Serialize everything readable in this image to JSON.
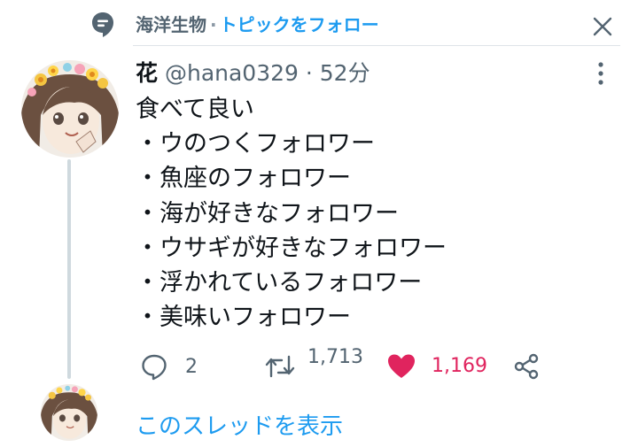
{
  "topic": {
    "icon": "topic-bubble-icon",
    "name": "海洋生物",
    "separator": "·",
    "follow_label": "トピックをフォロー"
  },
  "close_icon": "close-icon",
  "tweet": {
    "author_name": "花",
    "handle": "@hana0329",
    "separator": "·",
    "time": "52分",
    "more_icon": "more-vertical-icon",
    "lines": [
      "食べて良い",
      "・ウのつくフォロワー",
      "・魚座のフォロワー",
      "・海が好きなフォロワー",
      "・ウサギが好きなフォロワー",
      "・浮かれているフォロワー",
      "・美味いフォロワー"
    ],
    "actions": {
      "reply_count": "2",
      "retweet_count": "1,713",
      "like_count": "1,169",
      "liked": true
    }
  },
  "show_thread_label": "このスレッドを表示",
  "colors": {
    "accent": "#1d9bf0",
    "like": "#e0245e",
    "muted": "#536471",
    "divider": "#dfe4e8",
    "thread_line": "#cfd9de"
  }
}
